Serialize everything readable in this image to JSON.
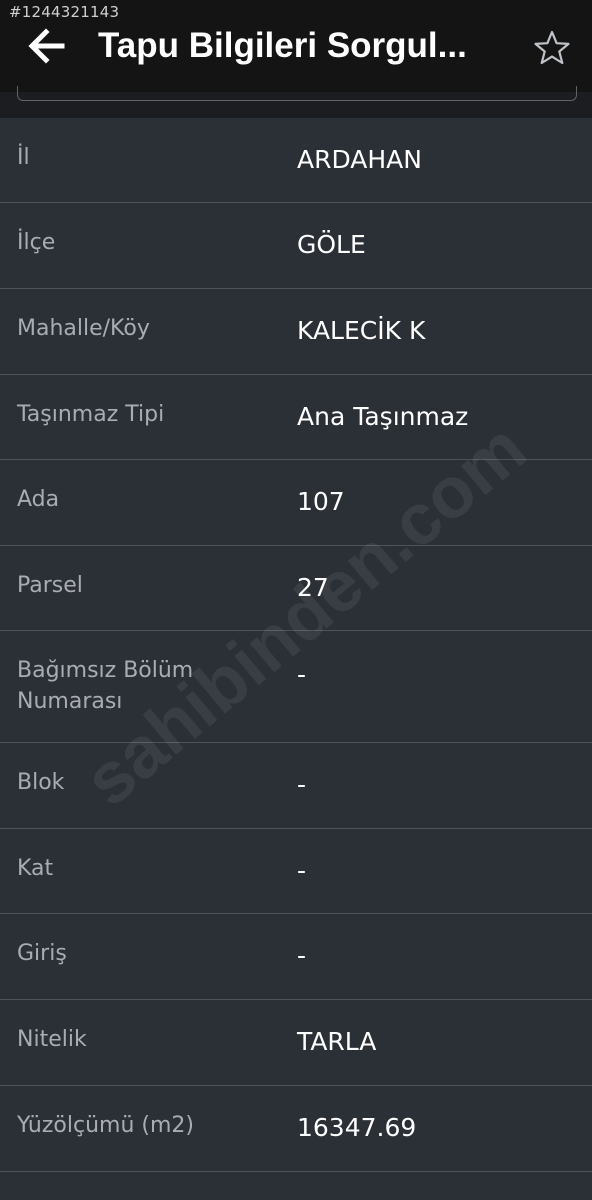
{
  "listing_id": "#1244321143",
  "appbar": {
    "title": "Tapu Bilgileri Sorgul...",
    "back_icon": "arrow-left-icon",
    "star_icon": "star-outline-icon"
  },
  "rows": [
    {
      "label": "İl",
      "value": "ARDAHAN"
    },
    {
      "label": "İlçe",
      "value": "GÖLE"
    },
    {
      "label": "Mahalle/Köy",
      "value": "KALECİK K"
    },
    {
      "label": "Taşınmaz Tipi",
      "value": "Ana Taşınmaz"
    },
    {
      "label": "Ada",
      "value": "107"
    },
    {
      "label": "Parsel",
      "value": "27"
    },
    {
      "label": "Bağımsız Bölüm Numarası",
      "value": "-"
    },
    {
      "label": "Blok",
      "value": "-"
    },
    {
      "label": "Kat",
      "value": "-"
    },
    {
      "label": "Giriş",
      "value": "-"
    },
    {
      "label": "Nitelik",
      "value": "TARLA"
    },
    {
      "label": "Yüzölçümü (m2)",
      "value": "16347.69"
    }
  ],
  "watermark": "sahibinden.com",
  "colors": {
    "background": "#2b2f36",
    "appbar": "#141414",
    "label": "#a9adb3",
    "value": "#ffffff",
    "divider": "#4e525a"
  }
}
